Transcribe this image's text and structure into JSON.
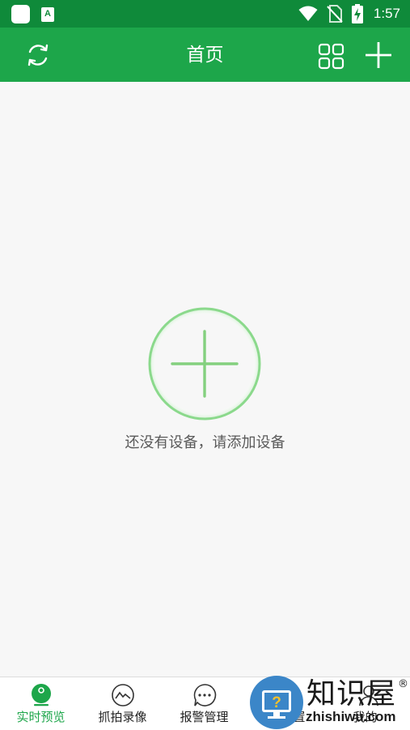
{
  "status_bar": {
    "time": "1:57",
    "a_icon_letter": "A",
    "icons": [
      "app-square-icon",
      "keyboard-a-icon",
      "wifi-icon",
      "no-sim-icon",
      "battery-charging-icon"
    ]
  },
  "app_bar": {
    "title": "首页",
    "icons": [
      "refresh-icon",
      "grid-view-icon",
      "plus-icon"
    ]
  },
  "content": {
    "empty_message": "还没有设备，请添加设备",
    "icon": "add-circle-icon"
  },
  "bottom_nav": {
    "items": [
      {
        "label": "实时预览",
        "icon": "camera-icon",
        "active": true
      },
      {
        "label": "抓拍录像",
        "icon": "picture-icon",
        "active": false
      },
      {
        "label": "报警管理",
        "icon": "chat-bubble-icon",
        "active": false
      },
      {
        "label": "设置",
        "icon": "settings-icon",
        "active": false
      },
      {
        "label": "我的",
        "icon": "user-icon",
        "active": false
      }
    ]
  },
  "watermark": {
    "cn": "知识屋",
    "en": "zhishiwu.com",
    "reg": "®",
    "badge_glyph": "?"
  },
  "colors": {
    "status_bar": "#0f8a3a",
    "app_bar": "#1da64a",
    "accent": "#1da64a",
    "background": "#f7f7f7",
    "add_circle": "#8bd98c"
  }
}
